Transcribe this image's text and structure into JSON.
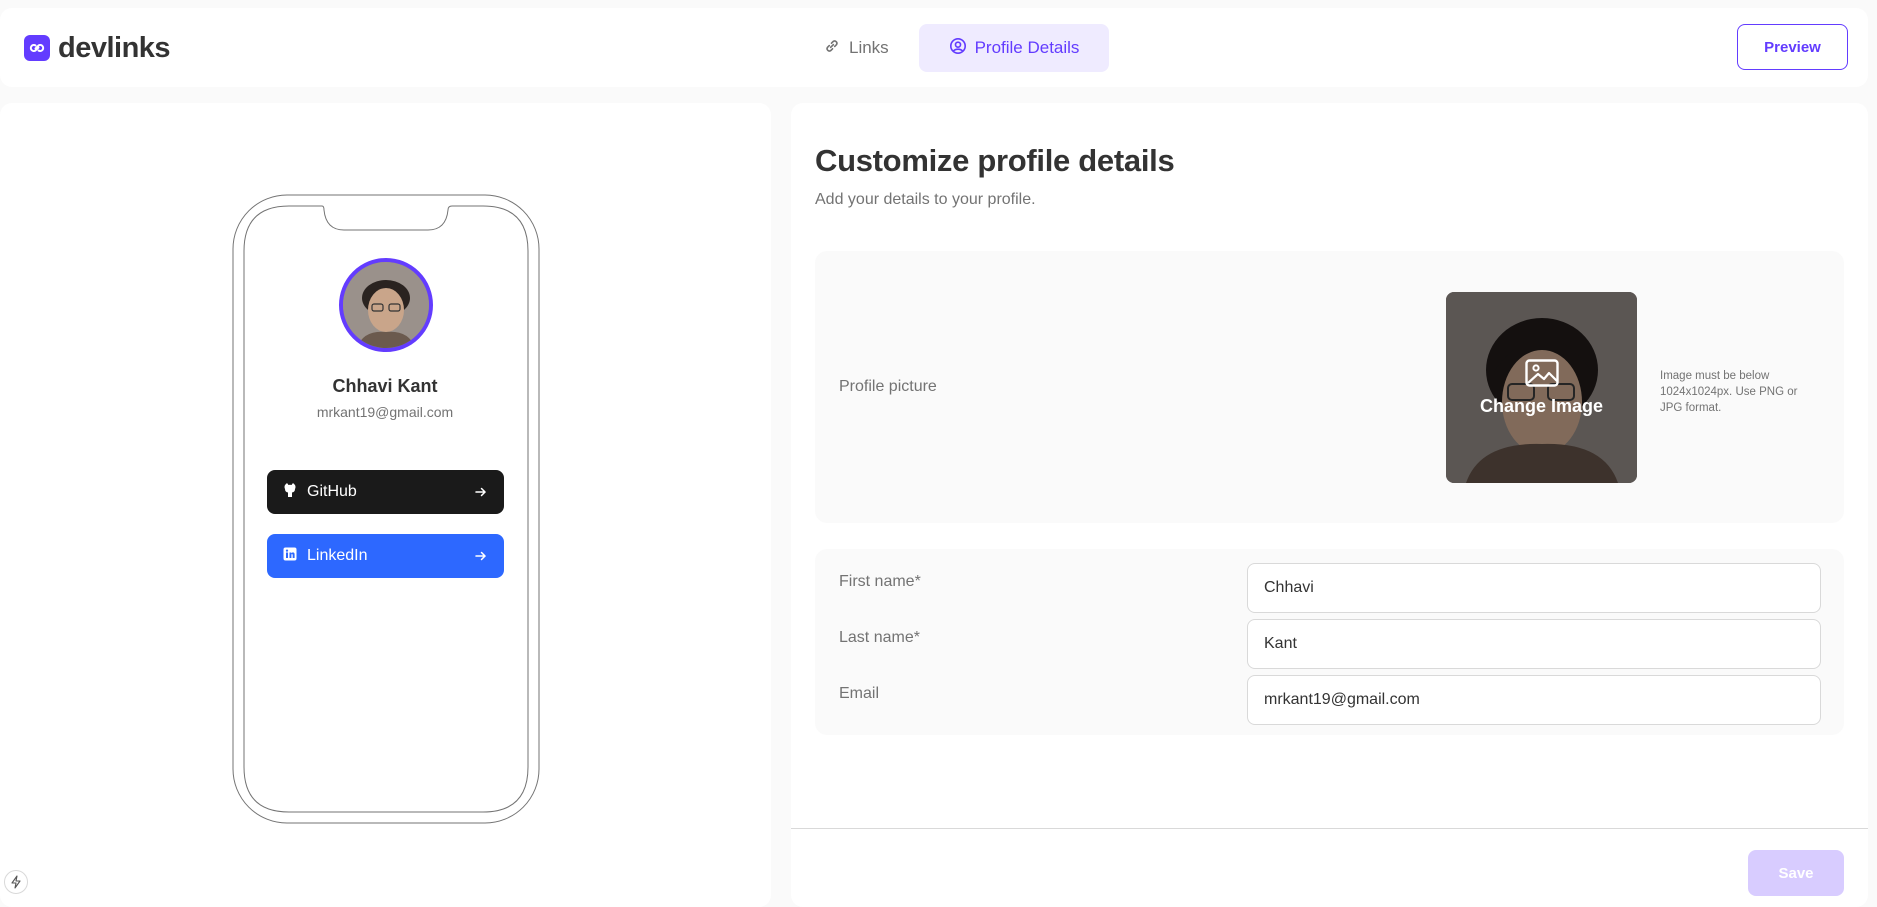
{
  "app": {
    "logo_text": "devlinks"
  },
  "nav": {
    "tabs": [
      {
        "label": "Links",
        "icon": "link-icon",
        "active": false
      },
      {
        "label": "Profile Details",
        "icon": "user-circle-icon",
        "active": true
      }
    ],
    "preview_label": "Preview"
  },
  "phone_preview": {
    "name": "Chhavi Kant",
    "email": "mrkant19@gmail.com",
    "links": [
      {
        "platform": "GitHub",
        "icon": "github-icon",
        "color": "#1a1a1a"
      },
      {
        "platform": "LinkedIn",
        "icon": "linkedin-icon",
        "color": "#2d68ff"
      }
    ]
  },
  "profile": {
    "title": "Customize profile details",
    "subtitle": "Add your details to your profile.",
    "picture": {
      "label": "Profile picture",
      "upload_label": "Change Image",
      "hint": "Image must be below 1024x1024px. Use PNG or JPG format."
    },
    "fields": {
      "first_name": {
        "label": "First name*",
        "value": "Chhavi"
      },
      "last_name": {
        "label": "Last name*",
        "value": "Kant"
      },
      "email": {
        "label": "Email",
        "value": "mrkant19@gmail.com"
      }
    },
    "save_label": "Save"
  },
  "colors": {
    "accent": "#633cff",
    "accent_light": "#efebff",
    "save_disabled": "#d8ccff",
    "github": "#1a1a1a",
    "linkedin": "#2d68ff"
  }
}
